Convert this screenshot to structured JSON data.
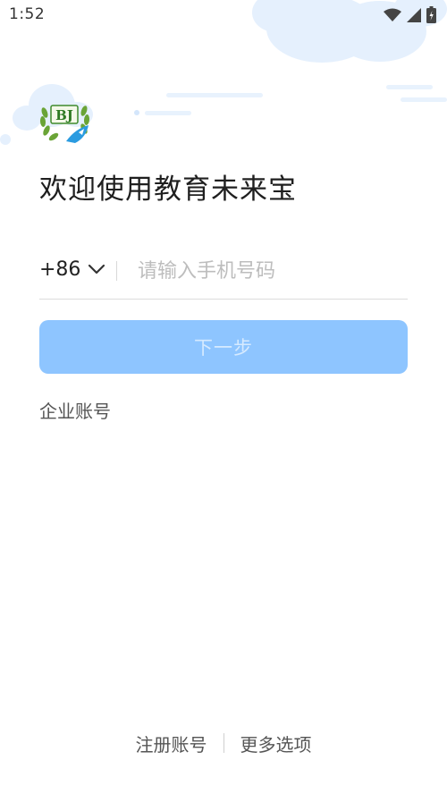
{
  "status_bar": {
    "time": "1:52",
    "icons": [
      "wifi-icon",
      "signal-icon",
      "battery-icon"
    ]
  },
  "login": {
    "welcome_text": "欢迎使用教育未来宝",
    "country_code": "+86",
    "phone_placeholder": "请输入手机号码",
    "next_button_label": "下一步",
    "enterprise_account_link": "企业账号"
  },
  "footer": {
    "register_link": "注册账号",
    "more_options_link": "更多选项"
  },
  "colors": {
    "primary_button": "#8ec5ff",
    "cloud": "#e3efff"
  }
}
